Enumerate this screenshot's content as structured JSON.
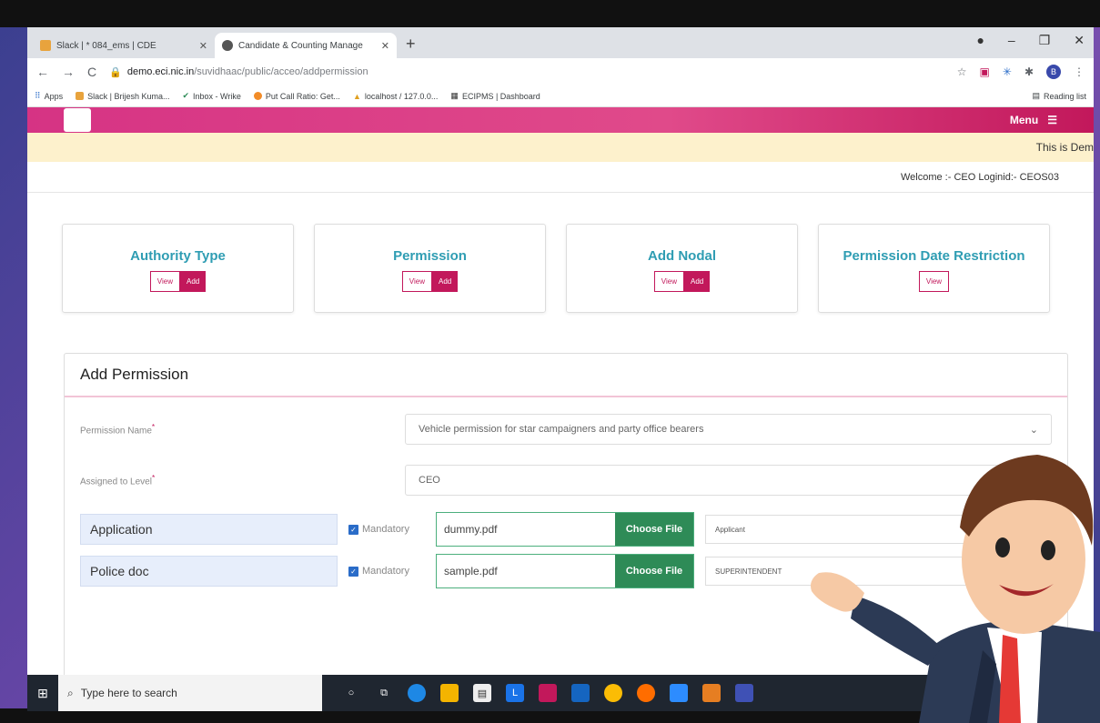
{
  "browser": {
    "tabs": [
      {
        "title": "Slack | * 084_ems | CDE",
        "active": false
      },
      {
        "title": "Candidate & Counting Manage",
        "active": true
      }
    ],
    "url_host": "demo.eci.nic.in",
    "url_path": "/suvidhaac/public/acceo/addpermission",
    "bookmarks": [
      "Apps",
      "Slack | Brijesh Kuma...",
      "Inbox - Wrike",
      "Put Call Ratio: Get...",
      "localhost / 127.0.0...",
      "ECIPMS | Dashboard"
    ],
    "reading_list": "Reading list",
    "profile_initial": "B"
  },
  "header": {
    "menu_label": "Menu"
  },
  "notice": "This is Dem",
  "welcome": "Welcome :- CEO Loginid:- CEOS03",
  "cards": [
    {
      "title": "Authority Type",
      "view": "View",
      "add": "Add"
    },
    {
      "title": "Permission",
      "view": "View",
      "add": "Add"
    },
    {
      "title": "Add Nodal",
      "view": "View",
      "add": "Add"
    },
    {
      "title": "Permission Date Restriction",
      "view": "View"
    }
  ],
  "form": {
    "title": "Add Permission",
    "permission_name_label": "Permission Name",
    "permission_name_value": "Vehicle permission for star campaigners and party office bearers",
    "assigned_label": "Assigned to Level",
    "assigned_value": "CEO",
    "documents": [
      {
        "name": "Application",
        "mandatory": "Mandatory",
        "file": "dummy.pdf",
        "choose": "Choose File",
        "assignee": "Applicant"
      },
      {
        "name": "Police doc",
        "mandatory": "Mandatory",
        "file": "sample.pdf",
        "choose": "Choose File",
        "assignee": "SUPERINTENDENT"
      }
    ]
  },
  "taskbar": {
    "search_placeholder": "Type here to search"
  }
}
